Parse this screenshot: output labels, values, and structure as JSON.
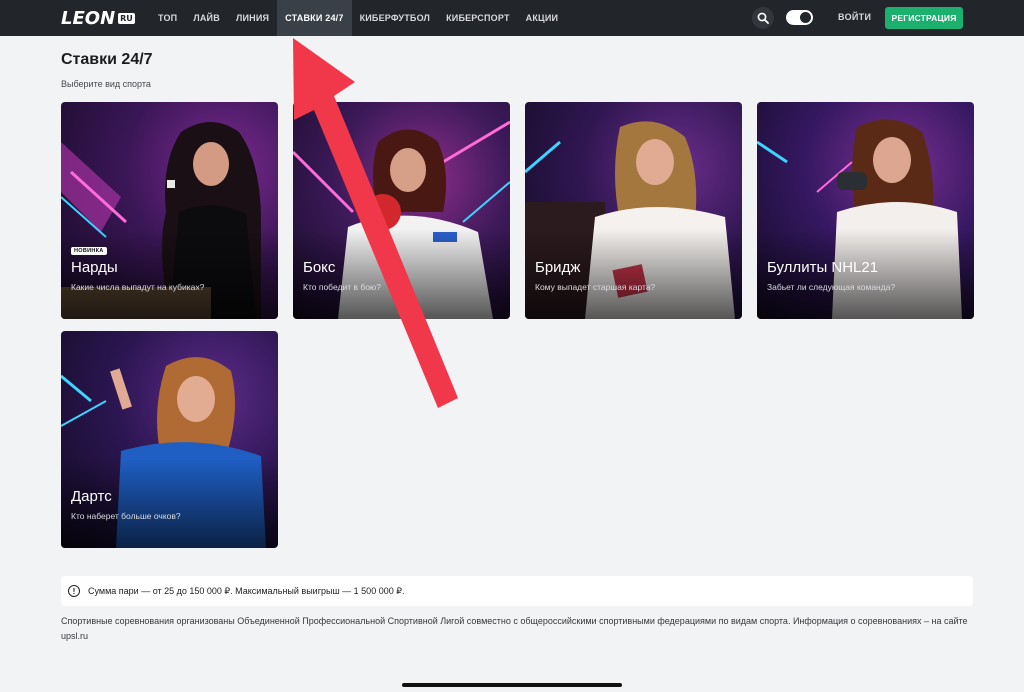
{
  "header": {
    "logo": "LEON",
    "logo_suffix": "RU",
    "nav": [
      {
        "label": "ТОП"
      },
      {
        "label": "ЛАЙВ"
      },
      {
        "label": "ЛИНИЯ"
      },
      {
        "label": "СТАВКИ 24/7",
        "active": true
      },
      {
        "label": "КИБЕРФУТБОЛ"
      },
      {
        "label": "КИБЕРСПОРТ"
      },
      {
        "label": "АКЦИИ"
      }
    ],
    "search_icon": "search-icon",
    "theme_toggle_icon": "theme-toggle-icon",
    "login_label": "ВОЙТИ",
    "register_label": "РЕГИСТРАЦИЯ"
  },
  "page": {
    "title": "Ставки 24/7",
    "subtitle": "Выберите вид спорта"
  },
  "cards": [
    {
      "badge": "НОВИНКА",
      "title": "Нарды",
      "desc": "Какие числа выпадут на кубиках?"
    },
    {
      "title": "Бокс",
      "desc": "Кто победит в бою?"
    },
    {
      "title": "Бридж",
      "desc": "Кому выпадет старшая карта?"
    },
    {
      "title": "Буллиты NHL21",
      "desc": "Забьет ли следующая команда?"
    },
    {
      "title": "Дартс",
      "desc": "Кто наберет больше очков?"
    }
  ],
  "info": {
    "icon": "info-icon",
    "text": "Сумма пари — от 25 до 150 000 ₽. Максимальный выигрыш — 1 500 000 ₽."
  },
  "footer": {
    "text": "Спортивные соревнования организованы Объединенной Профессиональной Спортивной Лигой совместно с общероссийскими спортивными федерациями по видам спорта. Информация о соревнованиях – на сайте upsl.ru"
  },
  "colors": {
    "header_bg": "#222529",
    "accent_green": "#1bb06e",
    "annotation_arrow": "#f0384a"
  }
}
